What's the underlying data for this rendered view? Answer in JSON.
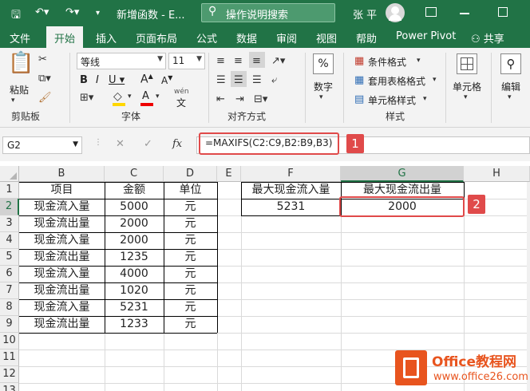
{
  "title_bar": {
    "doc_title": "新增函数 - E...",
    "search_placeholder": "操作说明搜索",
    "user": "张 平"
  },
  "menu": [
    "文件",
    "开始",
    "插入",
    "页面布局",
    "公式",
    "数据",
    "审阅",
    "视图",
    "帮助",
    "Power Pivot"
  ],
  "share_label": "共享",
  "ribbon": {
    "paste_label": "粘贴",
    "clipboard_label": "剪贴板",
    "font_name": "等线",
    "font_size": "11",
    "font_group_label": "字体",
    "wen_label": "wén",
    "align_group_label": "对齐方式",
    "number_label": "数字",
    "percent_label": "%",
    "cond_format": "条件格式",
    "table_format": "套用表格格式",
    "cell_style": "单元格样式",
    "style_group_label": "样式",
    "cells_label": "单元格",
    "edit_label": "编辑"
  },
  "formula_bar": {
    "name_box": "G2",
    "fx": "fx",
    "formula": "=MAXIFS(C2:C9,B2:B9,B3)"
  },
  "callouts": [
    "1",
    "2"
  ],
  "columns": [
    "A",
    "B",
    "C",
    "D",
    "E",
    "F",
    "G",
    "H"
  ],
  "rows": [
    "1",
    "2",
    "3",
    "4",
    "5",
    "6",
    "7",
    "8",
    "9",
    "10",
    "11",
    "12",
    "13"
  ],
  "table": {
    "headers": [
      "项目",
      "金额",
      "单位"
    ],
    "rows": [
      [
        "现金流入量",
        "5000",
        "元"
      ],
      [
        "现金流出量",
        "2000",
        "元"
      ],
      [
        "现金流入量",
        "2000",
        "元"
      ],
      [
        "现金流出量",
        "1235",
        "元"
      ],
      [
        "现金流入量",
        "4000",
        "元"
      ],
      [
        "现金流出量",
        "1020",
        "元"
      ],
      [
        "现金流入量",
        "5231",
        "元"
      ],
      [
        "现金流出量",
        "1233",
        "元"
      ]
    ]
  },
  "result": {
    "headers": [
      "最大现金流入量",
      "最大现金流出量"
    ],
    "values": [
      "5231",
      "2000"
    ]
  },
  "watermark": {
    "title": "Office教程网",
    "url": "www.office26.com"
  },
  "colors": {
    "excel_green": "#217346",
    "highlight_red": "#e04a4a",
    "watermark_orange": "#e8541e"
  }
}
